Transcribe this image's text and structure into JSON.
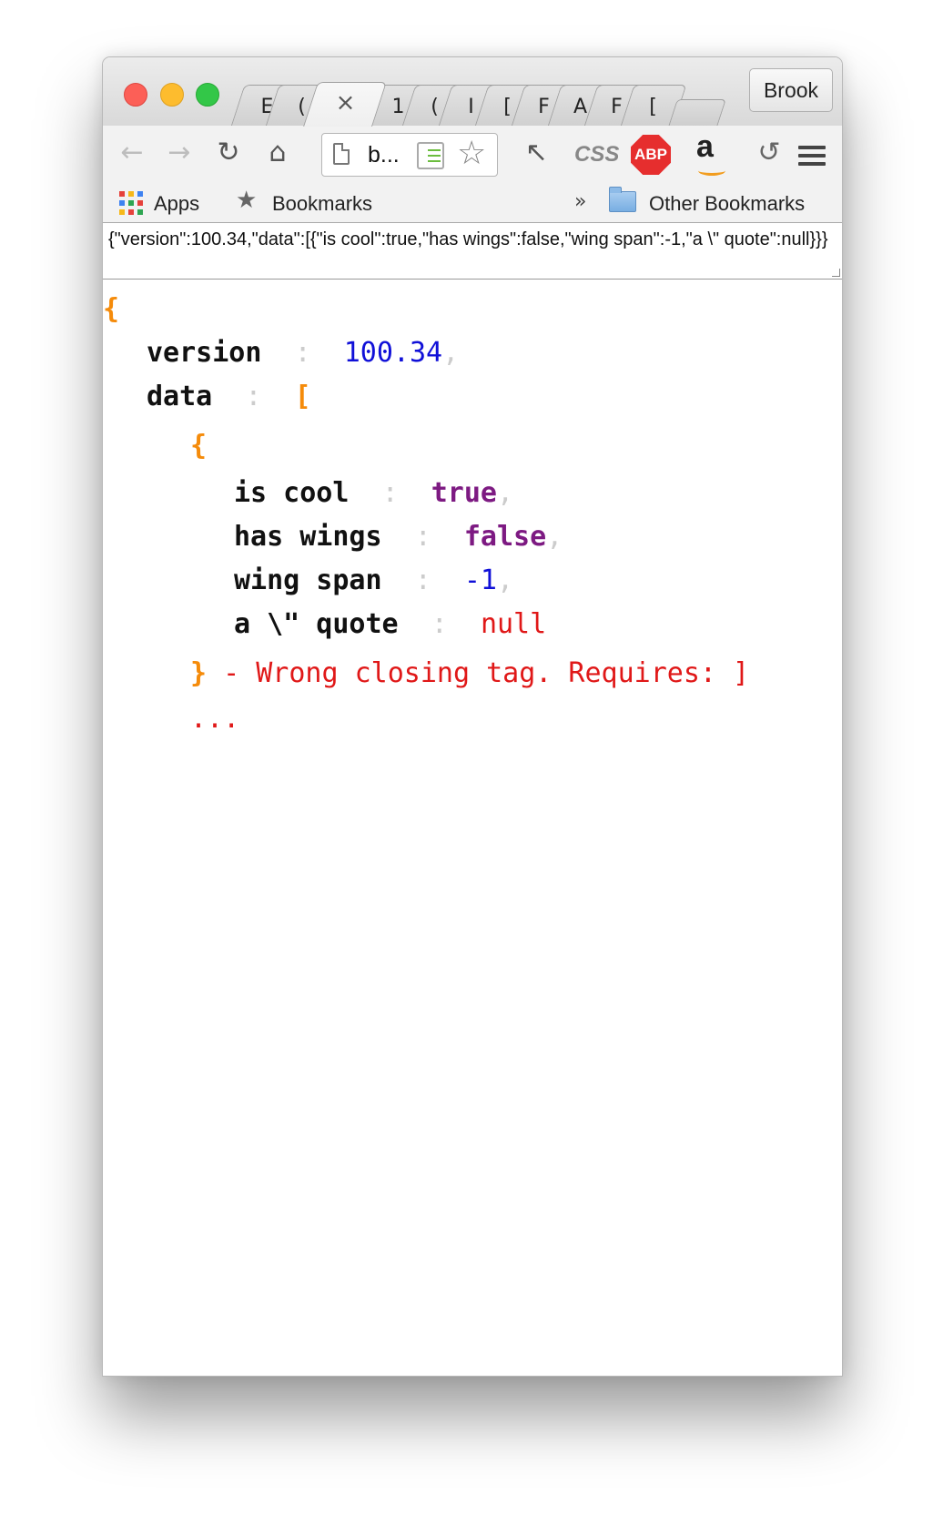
{
  "browser": {
    "tabs": [
      {
        "label": "E",
        "active": false
      },
      {
        "label": "(",
        "active": false
      },
      {
        "label": "×",
        "active": true
      },
      {
        "label": "1",
        "active": false
      },
      {
        "label": "(",
        "active": false
      },
      {
        "label": "I",
        "active": false
      },
      {
        "label": "[",
        "active": false
      },
      {
        "label": "F",
        "active": false
      },
      {
        "label": "A",
        "active": false
      },
      {
        "label": "F",
        "active": false
      },
      {
        "label": "[",
        "active": false
      }
    ],
    "profile_name": "Brook",
    "url_display": "b...",
    "toolbar": {
      "back_icon": "back-arrow-icon",
      "forward_icon": "forward-arrow-icon",
      "reload_icon": "reload-icon",
      "home_icon": "home-icon",
      "css_label": "CSS",
      "abp_label": "ABP",
      "amazon_label": "a"
    },
    "bookmarks": {
      "apps_label": "Apps",
      "bookmarks_label": "Bookmarks",
      "overflow_label": "»",
      "other_label": "Other Bookmarks"
    },
    "colors": {
      "brace": "#f58b0a",
      "number": "#1010d8",
      "boolean": "#7d1a82",
      "null": "#e01818",
      "error": "#e01818",
      "separator": "#cccccc"
    }
  },
  "json_input": "{\"version\":100.34,\"data\":[{\"is cool\":true,\"has wings\":false,\"wing span\":-1,\"a \\\" quote\":null}}}",
  "json_view": {
    "open_root": "{",
    "version_key": "version",
    "version_value": "100.34",
    "data_key": "data",
    "open_array": "[",
    "open_object": "{",
    "fields": [
      {
        "key": "is cool",
        "value": "true",
        "comma": ","
      },
      {
        "key": "has wings",
        "value": "false",
        "comma": ","
      },
      {
        "key": "wing span",
        "value": "-1",
        "comma": ","
      },
      {
        "key": "a \\\" quote",
        "value": "null",
        "comma": ""
      }
    ],
    "close_object": "}",
    "error_message": " - Wrong closing tag. Requires: ]",
    "ellipsis": "...",
    "colon": ":",
    "comma": ","
  }
}
